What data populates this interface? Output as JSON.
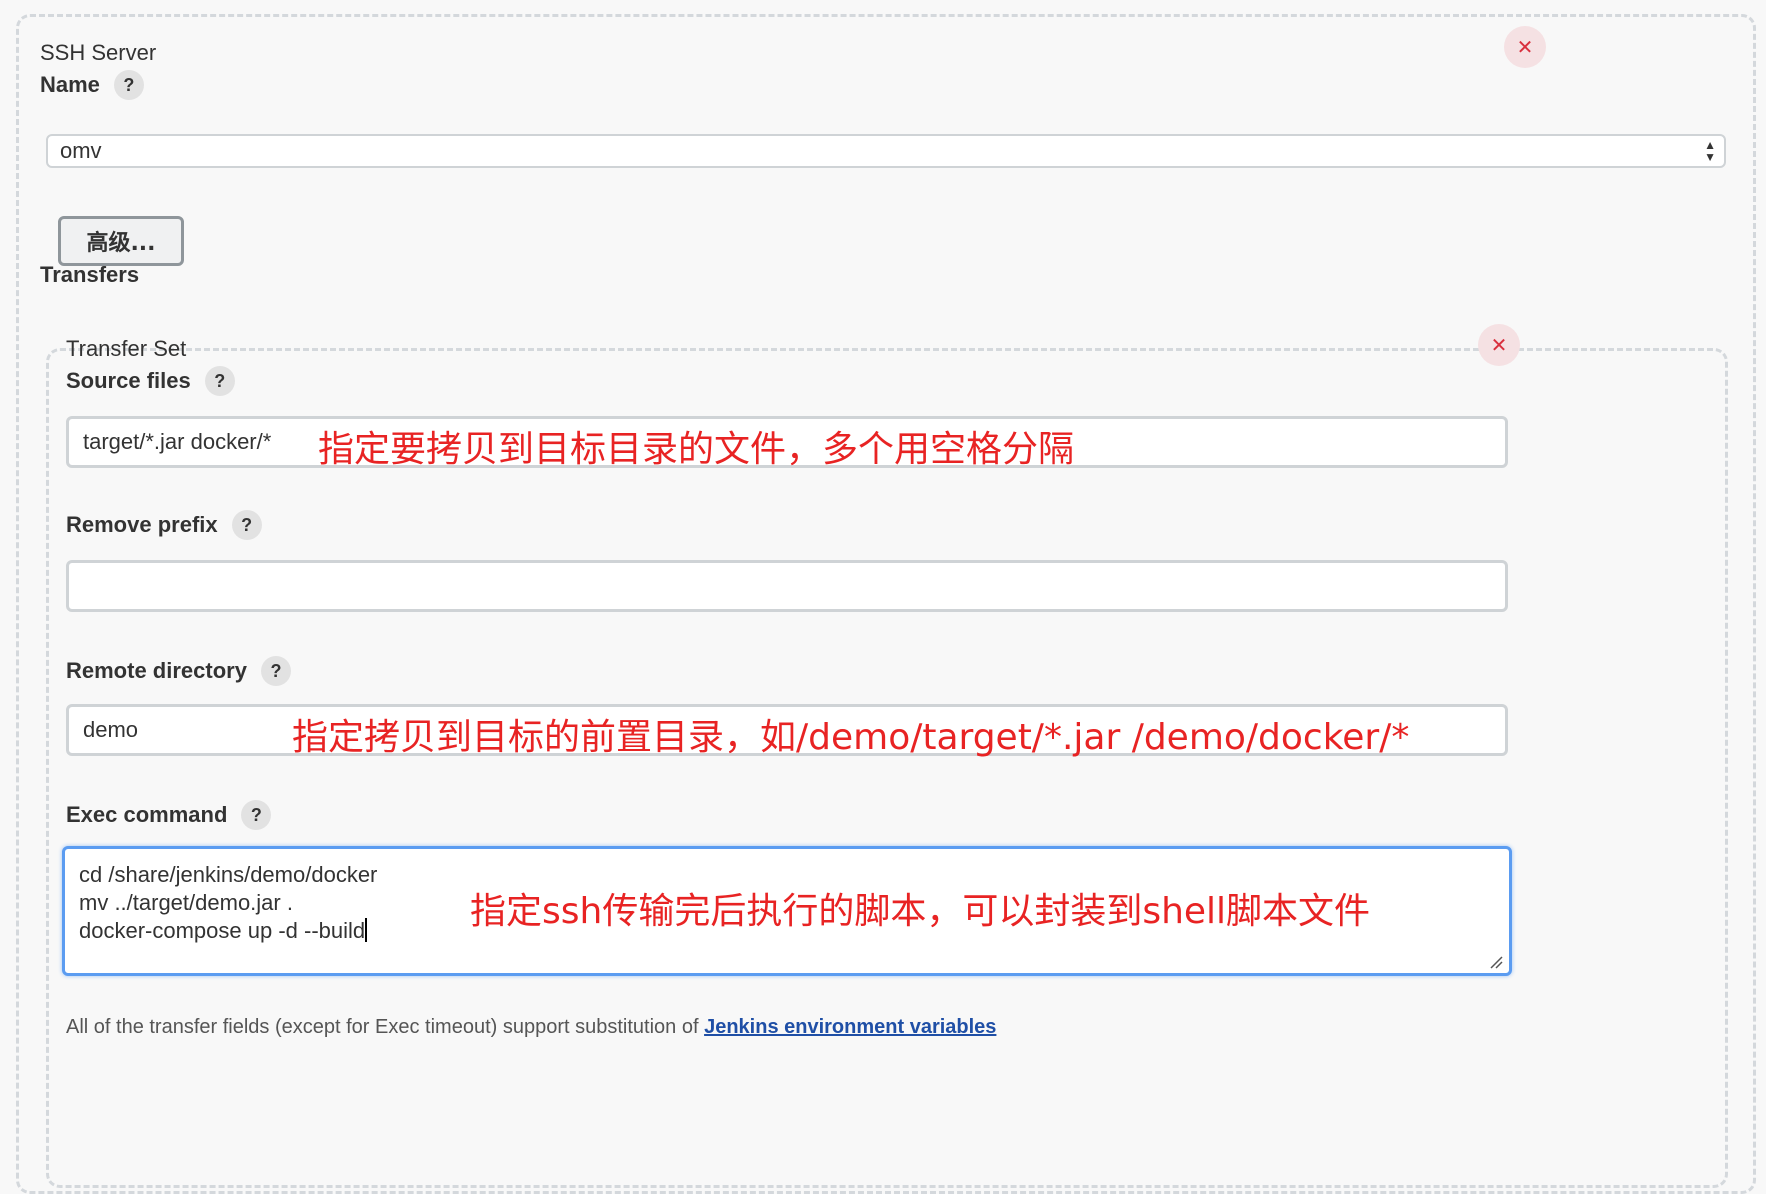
{
  "ssh_server": {
    "section_title": "SSH Server",
    "name_label": "Name",
    "help_glyph": "?",
    "name_value": "omv",
    "advanced_button": "高级...",
    "close_glyph": "✕"
  },
  "transfers": {
    "label": "Transfers",
    "transfer_set": {
      "title": "Transfer Set",
      "source_files": {
        "label": "Source files",
        "value": "target/*.jar docker/*",
        "annotation": "指定要拷贝到目标目录的文件，多个用空格分隔"
      },
      "remove_prefix": {
        "label": "Remove prefix",
        "value": ""
      },
      "remote_directory": {
        "label": "Remote directory",
        "value": "demo",
        "annotation": "指定拷贝到目标的前置目录，如/demo/target/*.jar /demo/docker/*"
      },
      "exec_command": {
        "label": "Exec command",
        "lines": [
          "cd /share/jenkins/demo/docker",
          "mv ../target/demo.jar .",
          "docker-compose up -d --build"
        ],
        "annotation": "指定ssh传输完后执行的脚本，可以封装到shell脚本文件"
      }
    }
  },
  "footnote": {
    "text": "All of the transfer fields (except for Exec timeout) support substitution of ",
    "link": "Jenkins environment variables"
  },
  "colors": {
    "annotation": "#e82323",
    "focus_border": "#5b9cf1",
    "close_bg": "#f5e1e3",
    "link": "#1f4fa6"
  }
}
